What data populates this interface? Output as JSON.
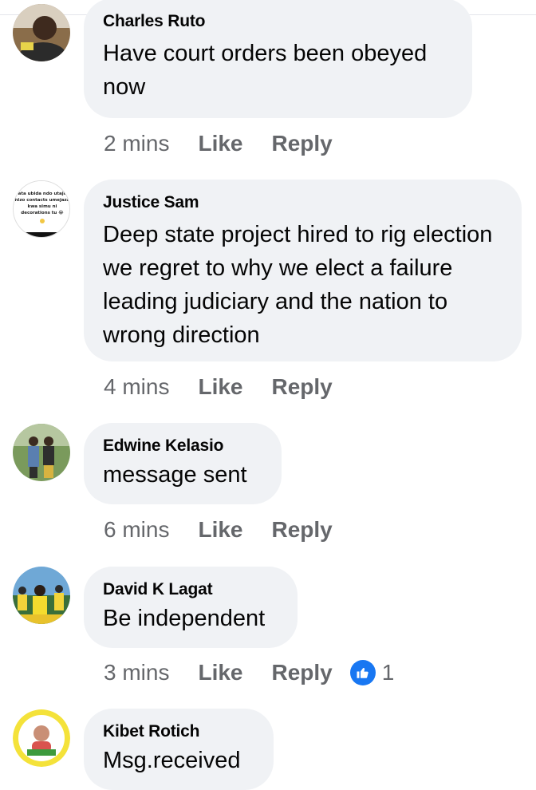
{
  "comments": [
    {
      "author": "Charles Ruto",
      "text": "Have court orders been obeyed now",
      "time": "2 mins",
      "like_label": "Like",
      "reply_label": "Reply",
      "avatar_icon": "user-photo-avatar"
    },
    {
      "author": "Justice Sam",
      "text": "Deep state project hired to rig election we regret to why we elect a failure leading judiciary and the nation to wrong direction",
      "time": "4 mins",
      "like_label": "Like",
      "reply_label": "Reply",
      "avatar_icon": "text-graphic-avatar",
      "avatar_text": "Pata ubida ndo utajua hizo contacts umejaza kwa simu ni decorations tu"
    },
    {
      "author": "Edwine Kelasio",
      "text": "message sent",
      "time": "6 mins",
      "like_label": "Like",
      "reply_label": "Reply",
      "avatar_icon": "two-people-photo-avatar"
    },
    {
      "author": "David K Lagat",
      "text": "Be independent",
      "time": "3 mins",
      "like_label": "Like",
      "reply_label": "Reply",
      "avatar_icon": "crowd-photo-avatar",
      "reaction": {
        "icon": "thumbs-up-icon",
        "count": "1"
      }
    },
    {
      "author": "Kibet Rotich",
      "text": "Msg.received",
      "avatar_icon": "badge-portrait-avatar"
    }
  ],
  "colors": {
    "bubble": "#f0f2f5",
    "meta_text": "#65676b",
    "like_blue": "#1877f2"
  }
}
